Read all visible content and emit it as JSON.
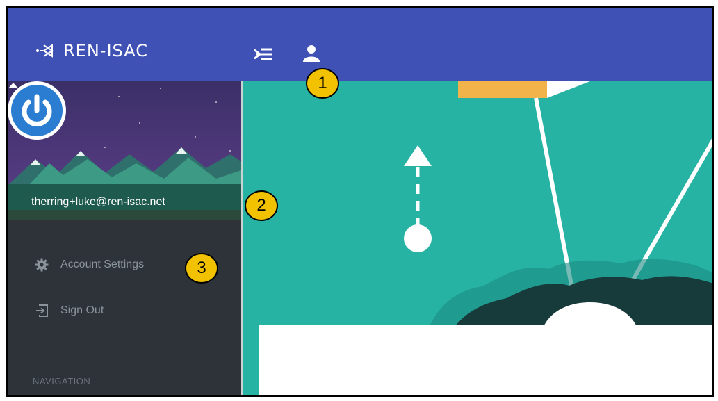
{
  "app": {
    "title": "REN-ISAC",
    "brand_color": "#3f51b5"
  },
  "header": {
    "menu_toggle_icon": "menu-collapse-icon",
    "user_icon": "user-icon"
  },
  "sidebar": {
    "user": {
      "email": "therring+luke@ren-isac.net",
      "avatar_icon": "power-icon"
    },
    "items": [
      {
        "label": "Account Settings",
        "icon": "gear-icon"
      },
      {
        "label": "Sign Out",
        "icon": "sign-out-icon"
      }
    ],
    "section_label": "NAVIGATION"
  },
  "callouts": [
    "1",
    "2",
    "3"
  ],
  "colors": {
    "sidebar": "#2e333a",
    "main_bg": "#26b3a4",
    "callout": "#f2c200"
  }
}
